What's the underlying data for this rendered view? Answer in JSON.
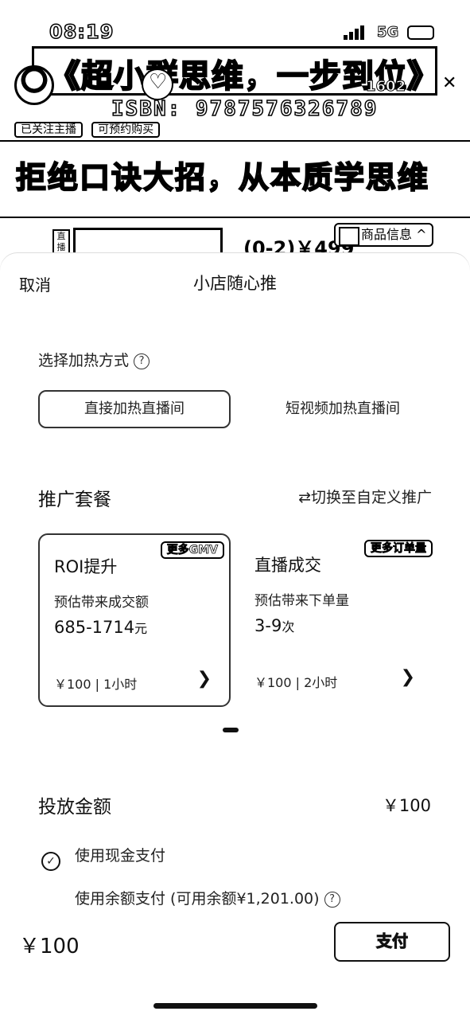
{
  "status_bar": {
    "time": "08:19",
    "network": "5G"
  },
  "stream": {
    "banner_title": "《超小群思维，一步到位》",
    "viewer_count": "1602",
    "isbn": "ISBN: 9787576326789",
    "tags": [
      "已关注主播",
      "可预约购买"
    ],
    "slogan": "拒绝口诀大招，从本质学思维",
    "live_price": "(0-2)￥499",
    "goods_info": "商品信息 ^"
  },
  "sheet": {
    "cancel_label": "取消",
    "title": "小店随心推",
    "heat_method": {
      "label": "选择加热方式",
      "options": [
        "直接加热直播间",
        "短视频加热直播间"
      ],
      "selected": 0
    },
    "package": {
      "title": "推广套餐",
      "switch_label": "⇄切换至自定义推广",
      "cards": [
        {
          "name": "ROI提升",
          "tag": "更多GMV",
          "metric_label": "预估带来成交额",
          "metric_value": "685-1714",
          "metric_unit": "元",
          "price_duration": "￥100 | 1小时"
        },
        {
          "name": "直播成交",
          "tag": "更多订单量",
          "metric_label": "预估带来下单量",
          "metric_value": "3-9",
          "metric_unit": "次",
          "price_duration": "￥100 | 2小时"
        }
      ],
      "selected": 0
    },
    "amount": {
      "label": "投放金额",
      "value": "￥100"
    },
    "payment": {
      "cash_label": "使用现金支付",
      "balance_label": "使用余额支付 (可用余额¥1,201.00)",
      "selected": "cash"
    },
    "total": "￥100",
    "pay_label": "支付"
  }
}
